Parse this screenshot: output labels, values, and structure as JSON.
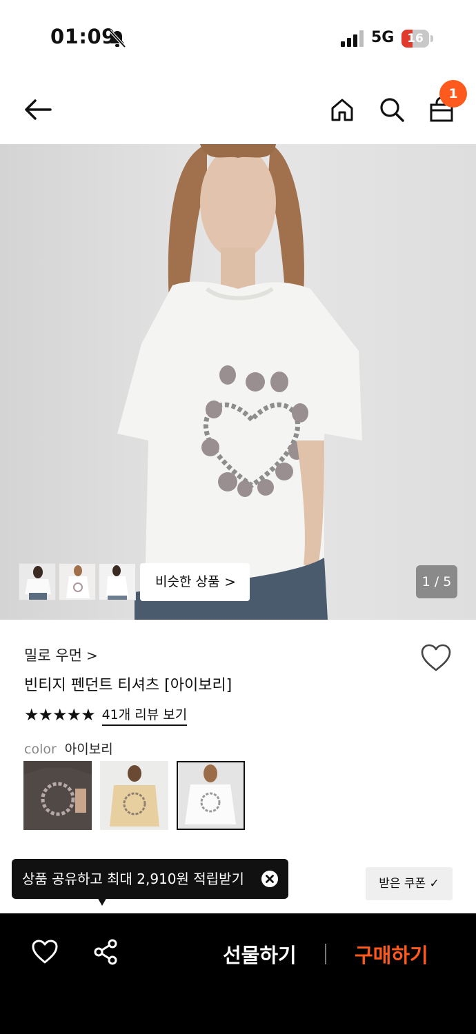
{
  "status_bar": {
    "time": "01:09",
    "network": "5G",
    "battery": "16"
  },
  "header": {
    "cart_count": "1"
  },
  "hero": {
    "pager": "1 / 5",
    "similar_label": "비슷한 상품",
    "similar_chevron": ">"
  },
  "product": {
    "brand": "밀로 우먼",
    "brand_chevron": ">",
    "title": "빈티지 펜던트 티셔츠 [아이보리]",
    "stars": "★★★★★",
    "review_link": "41개 리뷰 보기",
    "color_label": "color",
    "color_value": "아이보리"
  },
  "toast": {
    "text": "상품 공유하고 최대 2,910원 적립받기"
  },
  "coupon": {
    "label": "받은 쿠폰 ✓"
  },
  "bottom_bar": {
    "gift_label": "선물하기",
    "buy_label": "구매하기"
  },
  "colors": {
    "accent": "#ff5a1e",
    "dark": "#111111",
    "bar_bg": "#000000"
  }
}
